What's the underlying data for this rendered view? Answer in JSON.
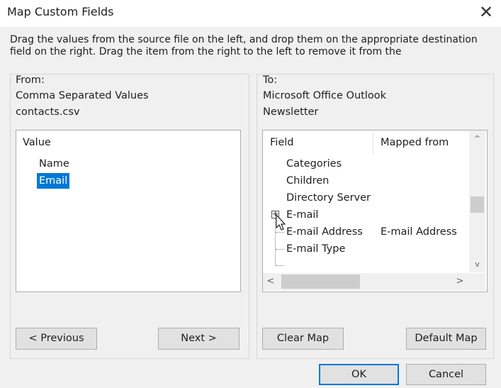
{
  "window": {
    "title": "Map Custom Fields",
    "close_glyph": "✕"
  },
  "instructions": "Drag the values from the source file on the left, and drop them on the appropriate destination field on the right.  Drag the item from the right to the left to remove it from the",
  "from": {
    "label": "From:",
    "source_type": "Comma Separated Values",
    "source_file": "contacts.csv",
    "column_header": "Value",
    "values": [
      "Name",
      "Email"
    ],
    "selected_value": "Email"
  },
  "to": {
    "label": "To:",
    "dest_app": "Microsoft Office Outlook",
    "dest_folder": "Newsletter",
    "col_field": "Field",
    "col_mapped": "Mapped from",
    "fields": [
      {
        "field": "Categories",
        "mapped": ""
      },
      {
        "field": "Children",
        "mapped": ""
      },
      {
        "field": "Directory Server",
        "mapped": ""
      },
      {
        "field": "E-mail",
        "mapped": "",
        "expander": "+"
      },
      {
        "field": "E-mail Address",
        "mapped": "E-mail Address"
      },
      {
        "field": "E-mail Type",
        "mapped": ""
      }
    ]
  },
  "buttons": {
    "previous": "< Previous",
    "next": "Next >",
    "clear_map": "Clear Map",
    "default_map": "Default Map",
    "ok": "OK",
    "cancel": "Cancel"
  },
  "scroll_glyphs": {
    "up": "^",
    "down": "v",
    "left": "<",
    "right": ">"
  },
  "accent_color": "#0078d7"
}
